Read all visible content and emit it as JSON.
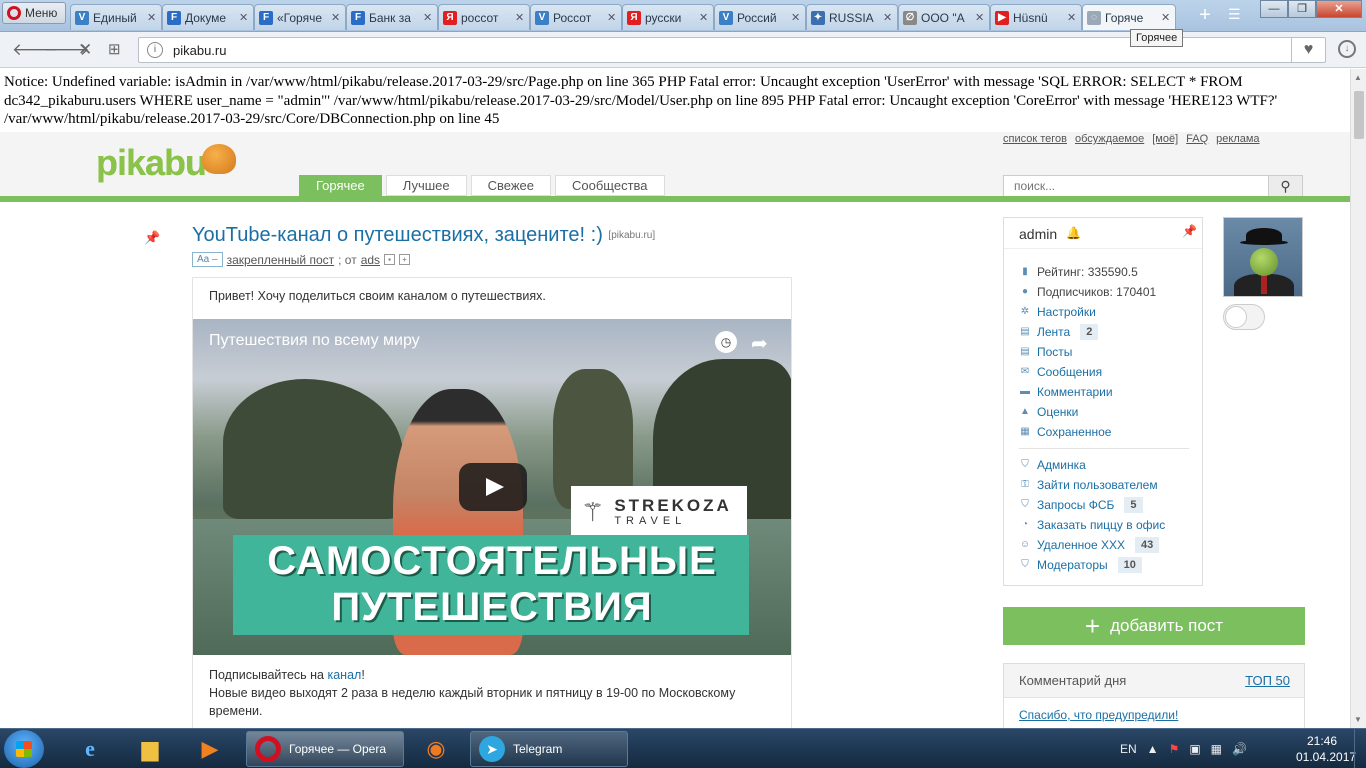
{
  "browser": {
    "menu_label": "Меню",
    "tabs": [
      {
        "title": "Единый",
        "favicon": "V",
        "color": "#3b7fc4"
      },
      {
        "title": "Докуме",
        "favicon": "F",
        "color": "#2b6cc4"
      },
      {
        "title": "«Горяче",
        "favicon": "F",
        "color": "#2b6cc4"
      },
      {
        "title": "Банк за",
        "favicon": "F",
        "color": "#2b6cc4"
      },
      {
        "title": "россот",
        "favicon": "Я",
        "color": "#e02020"
      },
      {
        "title": "Россот",
        "favicon": "V",
        "color": "#3b7fc4"
      },
      {
        "title": "русски",
        "favicon": "Я",
        "color": "#e02020"
      },
      {
        "title": "Россий",
        "favicon": "V",
        "color": "#3b7fc4"
      },
      {
        "title": "RUSSIA",
        "favicon": "✦",
        "color": "#3a6fb0"
      },
      {
        "title": "ООО \"А",
        "favicon": "∅",
        "color": "#888888"
      },
      {
        "title": "Hüsnü",
        "favicon": "▶",
        "color": "#e02020"
      },
      {
        "title": "Горяче",
        "favicon": "◌",
        "color": "#9aa8b8"
      }
    ],
    "tooltip": "Горячее",
    "url": "pikabu.ru"
  },
  "notice": "Notice: Undefined variable: isAdmin in /var/www/html/pikabu/release.2017-03-29/src/Page.php on line 365 PHP Fatal error: Uncaught exception 'UserError' with message 'SQL ERROR: SELECT * FROM dc342_pikaburu.users WHERE user_name = \"admin\"' /var/www/html/pikabu/release.2017-03-29/src/Model/User.php on line 895 PHP Fatal error: Uncaught exception 'CoreError' with message 'HERE123 WTF?' /var/www/html/pikabu/release.2017-03-29/src/Core/DBConnection.php on line 45",
  "header": {
    "logo": "pikabu",
    "top_links": [
      "список тегов",
      "обсуждаемое",
      "[моё]",
      "FAQ",
      "реклама"
    ],
    "nav": [
      "Горячее",
      "Лучшее",
      "Свежее",
      "Сообщества"
    ],
    "search_placeholder": "поиск..."
  },
  "post": {
    "title": "YouTube-канал о путешествиях, зацените! :)",
    "source": "[pikabu.ru]",
    "font_badge": "Aa –",
    "meta_pinned": "закрепленный пост",
    "meta_from": "; от",
    "meta_author": "ads",
    "intro": "Привет! Хочу поделиться своим каналом о путешествиях.",
    "video_title": "Путешествия по всему миру",
    "video_brand_name": "STREKOZA",
    "video_brand_sub": "TRAVEL",
    "video_banner_line1": "САМОСТОЯТЕЛЬНЫЕ",
    "video_banner_line2": "ПУТЕШЕСТВИЯ",
    "sub_prefix": "Подписывайтесь на ",
    "sub_link": "канал",
    "sub_suffix": "!",
    "sub_line2": "Новые видео выходят 2 раза в неделю каждый вторник и пятницу в 19-00 по Московскому времени."
  },
  "profile": {
    "username": "admin",
    "rating": "Рейтинг: 335590.5",
    "subscribers": "Подписчиков: 170401",
    "items": [
      {
        "label": "Настройки",
        "icon": "gear-icon",
        "glyph": "✲"
      },
      {
        "label": "Лента",
        "icon": "feed-icon",
        "glyph": "▤",
        "count": "2"
      },
      {
        "label": "Посты",
        "icon": "posts-icon",
        "glyph": "▤"
      },
      {
        "label": "Сообщения",
        "icon": "mail-icon",
        "glyph": "✉"
      },
      {
        "label": "Комментарии",
        "icon": "comment-icon",
        "glyph": "▬"
      },
      {
        "label": "Оценки",
        "icon": "rating-icon",
        "glyph": "▲"
      },
      {
        "label": "Сохраненное",
        "icon": "save-icon",
        "glyph": "▦"
      }
    ],
    "admin_items": [
      {
        "label": "Админка",
        "icon": "shield-icon",
        "glyph": "⛉"
      },
      {
        "label": "Зайти пользователем",
        "icon": "user-key-icon",
        "glyph": "⚿"
      },
      {
        "label": "Запросы ФСБ",
        "icon": "shield-icon",
        "glyph": "⛉",
        "count": "5"
      },
      {
        "label": "Заказать пиццу в офис",
        "icon": "pie-icon",
        "glyph": "◔"
      },
      {
        "label": "Удаленное XXX",
        "icon": "smile-icon",
        "glyph": "☺",
        "count": "43"
      },
      {
        "label": "Модераторы",
        "icon": "shield-icon",
        "glyph": "⛉",
        "count": "10"
      }
    ]
  },
  "add_post": "добавить пост",
  "comment_of_day": {
    "title": "Комментарий дня",
    "top": "ТОП 50",
    "text": "Спасибо, что предупредили!"
  },
  "taskbar": {
    "apps": [
      {
        "label": "Горячее — Opera"
      },
      {
        "label": "Telegram"
      }
    ],
    "lang": "EN",
    "time": "21:46",
    "date": "01.04.2017"
  },
  "colors": {
    "pikabu_green": "#7bbf5e",
    "link_blue": "#1a6fa5"
  }
}
